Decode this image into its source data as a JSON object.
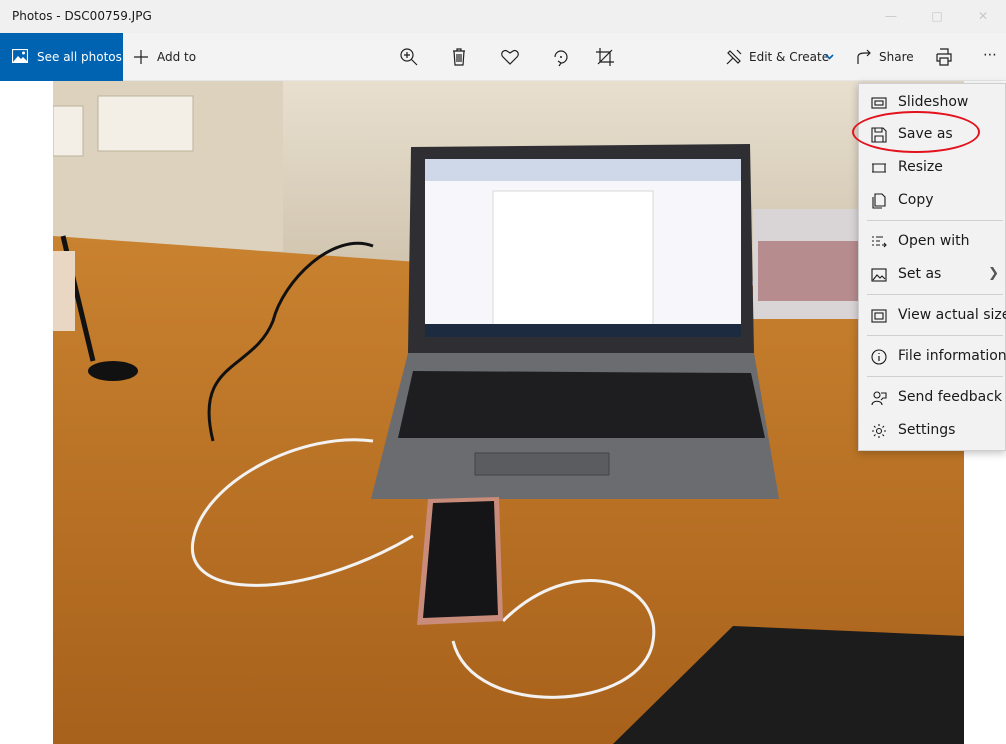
{
  "window": {
    "title": "Photos - DSC00759.JPG",
    "minimize_icon": "minimize-icon",
    "maximize_icon": "maximize-icon",
    "close_icon": "close-icon"
  },
  "toolbar": {
    "see_all_label": "See all photos",
    "add_to_label": "Add to",
    "edit_create_label": "Edit & Create",
    "share_label": "Share",
    "icons": [
      "zoom-icon",
      "delete-icon",
      "favorite-icon",
      "rotate-icon",
      "crop-icon",
      "print-icon",
      "more-icon"
    ]
  },
  "menu": {
    "items": [
      {
        "label": "Slideshow",
        "icon": "slideshow-icon"
      },
      {
        "label": "Save as",
        "icon": "save-icon"
      },
      {
        "label": "Resize",
        "icon": "resize-icon"
      },
      {
        "label": "Copy",
        "icon": "copy-icon"
      },
      {
        "label": "Open with",
        "icon": "open-with-icon"
      },
      {
        "label": "Set as",
        "icon": "set-as-icon",
        "submenu": true
      },
      {
        "label": "View actual size",
        "icon": "actual-size-icon"
      },
      {
        "label": "File information",
        "icon": "info-icon"
      },
      {
        "label": "Send feedback",
        "icon": "feedback-icon"
      },
      {
        "label": "Settings",
        "icon": "settings-icon"
      }
    ],
    "highlighted_item": "Save as",
    "highlight_color": "#e3121c"
  },
  "colors": {
    "accent": "#0063b1",
    "edit_chevron": "#0063b1"
  },
  "photo": {
    "subject": "laptop-and-phone-on-desk"
  }
}
